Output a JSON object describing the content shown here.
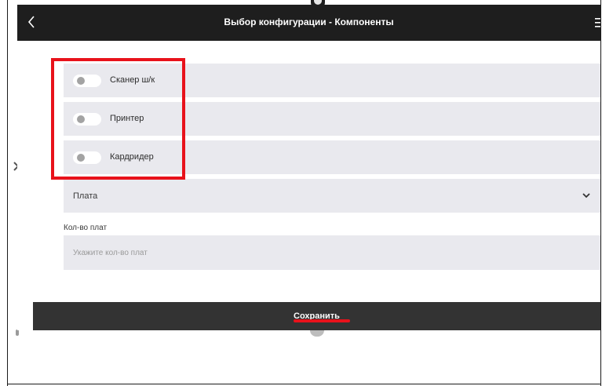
{
  "appbar": {
    "title": "Выбор конфигурации - Компоненты",
    "back_icon": "chevron-left-icon",
    "menu_icon": "menu-icon"
  },
  "components": [
    {
      "label": "Сканер ш/к",
      "enabled": false
    },
    {
      "label": "Принтер",
      "enabled": false
    },
    {
      "label": "Кардридер",
      "enabled": false
    }
  ],
  "board_select": {
    "value": "Плата",
    "icon": "chevron-down-icon"
  },
  "board_count": {
    "caption": "Кол-во плат",
    "placeholder": "Укажите кол-во плат"
  },
  "save": {
    "label": "Сохранить"
  },
  "colors": {
    "appbar": "#1e1e1e",
    "row": "#e9e9ee",
    "highlight": "#e8121b",
    "save_bar": "#333333"
  }
}
